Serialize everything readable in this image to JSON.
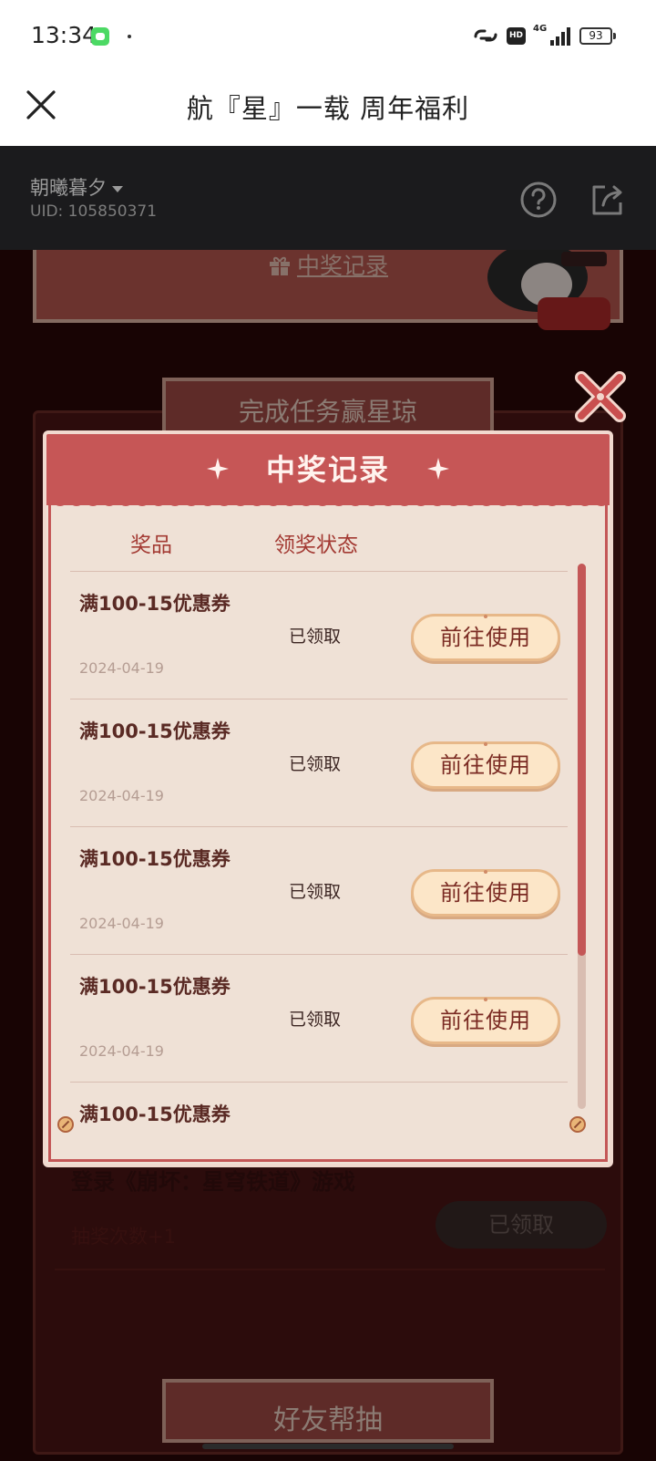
{
  "status_bar": {
    "time": "13:34",
    "hd": "HD",
    "network": "4G",
    "battery": "93"
  },
  "title_bar": {
    "title": "航『星』一载 周年福利"
  },
  "user": {
    "name": "朝曦暮夕",
    "uid": "UID: 105850371"
  },
  "background_page": {
    "record_link": "中奖记录",
    "task_section_title": "完成任务赢星琼",
    "task_title": "登录《崩坏：星穹铁道》游戏",
    "task_reward": "抽奖次数+1",
    "task_button": "已领取",
    "friend_section_title": "好友帮抽"
  },
  "modal": {
    "title": "中奖记录",
    "columns": {
      "prize": "奖品",
      "status": "领奖状态"
    },
    "records": [
      {
        "prize": "满100-15优惠券",
        "date": "2024-04-19",
        "status": "已领取",
        "action": "前往使用"
      },
      {
        "prize": "满100-15优惠券",
        "date": "2024-04-19",
        "status": "已领取",
        "action": "前往使用"
      },
      {
        "prize": "满100-15优惠券",
        "date": "2024-04-19",
        "status": "已领取",
        "action": "前往使用"
      },
      {
        "prize": "满100-15优惠券",
        "date": "2024-04-19",
        "status": "已领取",
        "action": "前往使用"
      },
      {
        "prize": "满100-15优惠券",
        "date": "",
        "status": "",
        "action": ""
      }
    ]
  },
  "colors": {
    "modal_header": "#c65656",
    "modal_body": "#efe1d6",
    "button_fill": "#fce6c8",
    "page_background": "#2a0707"
  },
  "icons": [
    "close-icon",
    "help-icon",
    "share-icon",
    "gift-icon",
    "sparkle-icon",
    "modal-close-icon"
  ]
}
